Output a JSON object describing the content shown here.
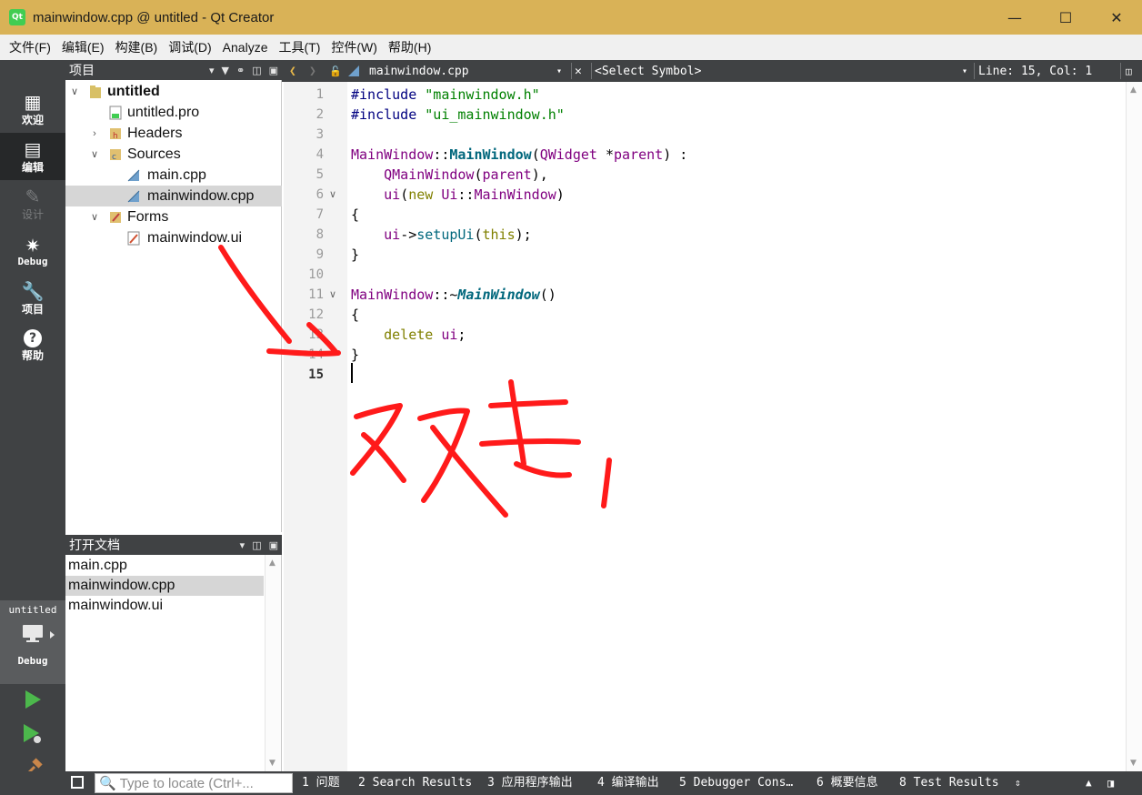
{
  "window": {
    "app_icon": "Qt",
    "title": "mainwindow.cpp @ untitled - Qt Creator",
    "buttons": [
      "minimize",
      "maximize",
      "close"
    ]
  },
  "menubar": {
    "items": [
      "文件(F)",
      "编辑(E)",
      "构建(B)",
      "调试(D)",
      "Analyze",
      "工具(T)",
      "控件(W)",
      "帮助(H)"
    ]
  },
  "modes": [
    {
      "label": "欢迎",
      "icon": "grid-icon",
      "active": false
    },
    {
      "label": "编辑",
      "icon": "document-icon",
      "active": true
    },
    {
      "label": "设计",
      "icon": "pencil-icon",
      "active": false
    },
    {
      "label": "Debug",
      "icon": "bug-icon",
      "active": false
    },
    {
      "label": "项目",
      "icon": "wrench-icon",
      "active": false
    },
    {
      "label": "帮助",
      "icon": "help-icon",
      "active": false
    }
  ],
  "kit": {
    "project": "untitled",
    "build": "Debug"
  },
  "project_pane": {
    "title": "项目",
    "tree": [
      {
        "label": "untitled",
        "level": 0,
        "expanded": true,
        "bold": true
      },
      {
        "label": "untitled.pro",
        "level": 1
      },
      {
        "label": "Headers",
        "level": 1,
        "expanded": false
      },
      {
        "label": "Sources",
        "level": 1,
        "expanded": true
      },
      {
        "label": "main.cpp",
        "level": 2
      },
      {
        "label": "mainwindow.cpp",
        "level": 2,
        "selected": true
      },
      {
        "label": "Forms",
        "level": 1,
        "expanded": true
      },
      {
        "label": "mainwindow.ui",
        "level": 2
      }
    ]
  },
  "open_docs": {
    "title": "打开文档",
    "items": [
      {
        "label": "main.cpp",
        "selected": false
      },
      {
        "label": "mainwindow.cpp",
        "selected": true
      },
      {
        "label": "mainwindow.ui",
        "selected": false
      }
    ]
  },
  "editor_bar": {
    "file": "mainwindow.cpp",
    "symbol": "<Select Symbol>",
    "position": "Line: 15, Col: 1"
  },
  "editor": {
    "current_line": 15,
    "lines": [
      {
        "n": "1",
        "text": "#include \"mainwindow.h\""
      },
      {
        "n": "2",
        "text": "#include \"ui_mainwindow.h\""
      },
      {
        "n": "3",
        "text": ""
      },
      {
        "n": "4",
        "text": "MainWindow::MainWindow(QWidget *parent) :"
      },
      {
        "n": "5",
        "text": "    QMainWindow(parent),"
      },
      {
        "n": "6",
        "text": "    ui(new Ui::MainWindow)"
      },
      {
        "n": "7",
        "text": "{"
      },
      {
        "n": "8",
        "text": "    ui->setupUi(this);"
      },
      {
        "n": "9",
        "text": "}"
      },
      {
        "n": "10",
        "text": ""
      },
      {
        "n": "11",
        "text": "MainWindow::~MainWindow()"
      },
      {
        "n": "12",
        "text": "{"
      },
      {
        "n": "13",
        "text": "    delete ui;"
      },
      {
        "n": "14",
        "text": "}"
      },
      {
        "n": "15",
        "text": ""
      }
    ]
  },
  "statusbar": {
    "locate_placeholder": "Type to locate (Ctrl+...",
    "panes": [
      "1 问题",
      "2 Search Results",
      "3 应用程序输出",
      "4 编译输出",
      "5 Debugger Cons…",
      "6 概要信息",
      "8 Test Results"
    ]
  },
  "colors": {
    "titlebar": "#d9b257",
    "sidebar": "#404244",
    "annotation": "#ff1a1a"
  }
}
